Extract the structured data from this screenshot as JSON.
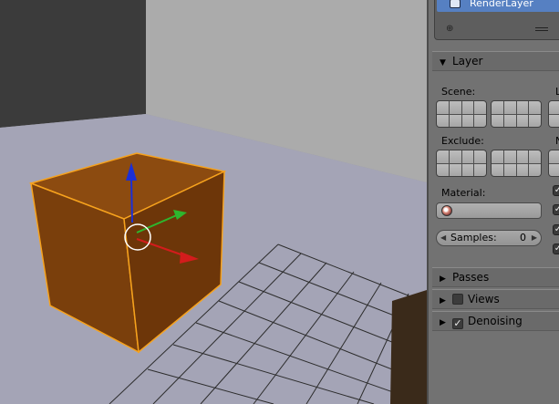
{
  "render_layers": {
    "items": [
      {
        "label": "RenderLayer"
      }
    ]
  },
  "layer_panel": {
    "title": "Layer",
    "scene_label": "Scene:",
    "scene_right_label": "L",
    "exclude_label": "Exclude:",
    "exclude_right_label": "N",
    "material_label": "Material:",
    "material_value": "",
    "samples_label": "Samples:",
    "samples_value": "0"
  },
  "collapsed_panels": [
    {
      "title": "Passes",
      "has_checkbox": false
    },
    {
      "title": "Views",
      "has_checkbox": true,
      "checked": false
    },
    {
      "title": "Denoising",
      "has_checkbox": true,
      "checked": true
    }
  ],
  "colors": {
    "cube_face_front": "#7a3f0c",
    "cube_face_top": "#8c4b10",
    "cube_face_side": "#6d3609",
    "selection_outline": "#f6a21d",
    "floor": "#a4a4b4",
    "back_wall": "#aaaaaa",
    "dark_wall": "#3b3b3b",
    "axis_x": "#d31c1c",
    "axis_y": "#2eb62e",
    "axis_z": "#1b2fd6",
    "panel_bg": "#727272",
    "selected_row": "#5680c2"
  },
  "icons": {
    "render_layer": "render-layer-icon",
    "add": "add-icon",
    "list_menu": "list-menu-icon",
    "material": "material-sphere-icon"
  }
}
